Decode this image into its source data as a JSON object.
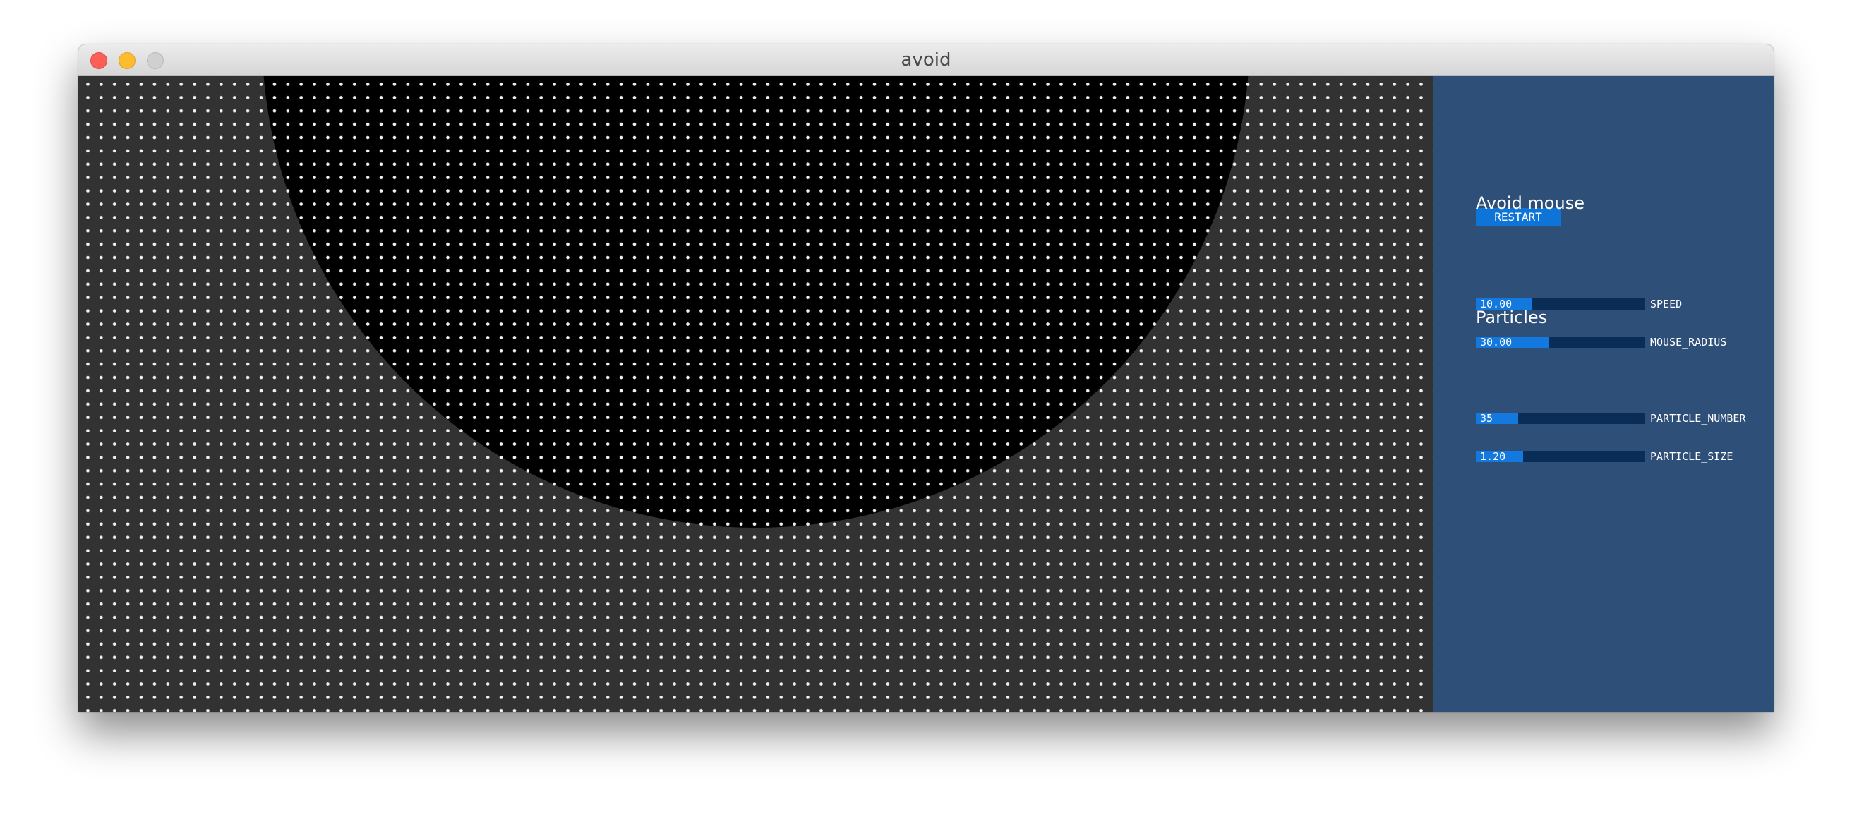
{
  "window": {
    "title": "avoid"
  },
  "panel": {
    "restart_label": "RESTART",
    "groups": [
      {
        "title": "Avoid mouse",
        "sliders": [
          {
            "label": "SPEED",
            "value": "10.00",
            "fill_fraction": 0.33
          },
          {
            "label": "MOUSE_RADIUS",
            "value": "30.00",
            "fill_fraction": 0.43
          }
        ]
      },
      {
        "title": "Particles",
        "sliders": [
          {
            "label": "PARTICLE_NUMBER",
            "value": "35",
            "fill_fraction": 0.25
          },
          {
            "label": "PARTICLE_SIZE",
            "value": "1.20",
            "fill_fraction": 0.28
          }
        ]
      }
    ]
  },
  "colors": {
    "canvas_bg": "#323232",
    "avoid_region": "#000000",
    "particle": "#f2f2f2",
    "panel_bg": "#2e4f78",
    "slider_track": "#0a2d58",
    "slider_fill": "#1479df",
    "button_bg": "#0f74d8"
  }
}
